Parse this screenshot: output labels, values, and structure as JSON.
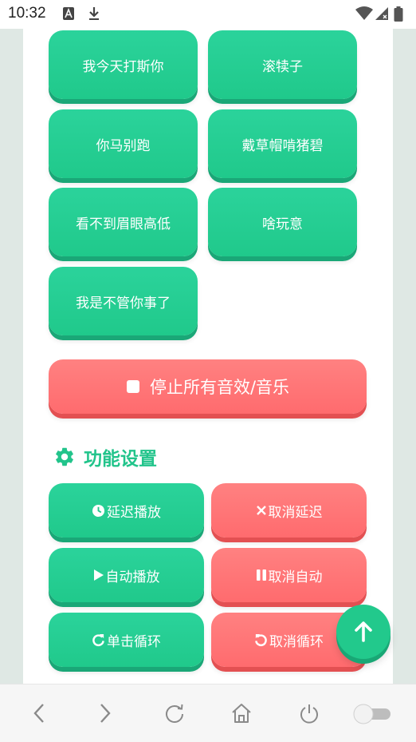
{
  "status_bar": {
    "time": "10:32",
    "icons": [
      "text-notification-icon",
      "download-icon",
      "wifi-icon",
      "cell-signal-icon",
      "battery-icon"
    ]
  },
  "sound_buttons": [
    {
      "label": "我今天打斯你"
    },
    {
      "label": "滚犊子"
    },
    {
      "label": "你马别跑"
    },
    {
      "label": "戴草帽啃猪碧"
    },
    {
      "label": "看不到眉眼高低"
    },
    {
      "label": "啥玩意"
    },
    {
      "label": "我是不管你事了"
    }
  ],
  "stop_button": {
    "label": "停止所有音效/音乐",
    "icon": "stop-icon"
  },
  "settings": {
    "title": "功能设置",
    "icon": "gear-icon",
    "buttons": [
      {
        "label": "延迟播放",
        "icon": "clock-icon"
      },
      {
        "label": "取消延迟",
        "icon": "close-icon"
      },
      {
        "label": "自动播放",
        "icon": "play-icon"
      },
      {
        "label": "取消自动",
        "icon": "pause-icon"
      },
      {
        "label": "单击循环",
        "icon": "redo-icon"
      },
      {
        "label": "取消循环",
        "icon": "undo-icon"
      }
    ]
  },
  "fab": {
    "icon": "arrow-up-icon"
  },
  "nav_bar": {
    "items": [
      "back-icon",
      "forward-icon",
      "refresh-icon",
      "home-icon",
      "power-icon",
      "toggle-switch"
    ]
  },
  "colors": {
    "green": "#22c98c",
    "red": "#ff6b6e",
    "title_green": "#22c48b"
  }
}
